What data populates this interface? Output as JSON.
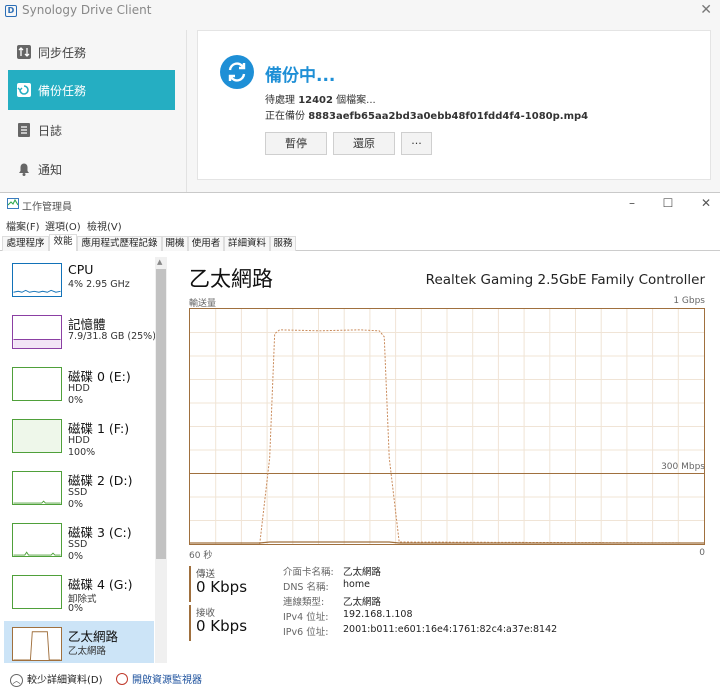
{
  "synology": {
    "title": "Synology Drive Client",
    "nav": [
      {
        "label": "同步任務",
        "icon": "sync-arrows-icon",
        "active": false
      },
      {
        "label": "備份任務",
        "icon": "backup-icon",
        "active": true
      },
      {
        "label": "日誌",
        "icon": "log-icon",
        "active": false
      },
      {
        "label": "通知",
        "icon": "bell-icon",
        "active": false
      }
    ],
    "status": "備份中...",
    "pending_prefix": "待處理",
    "pending_count": "12402",
    "pending_suffix": "個檔案...",
    "current_prefix": "正在備份",
    "current_file": "8883aefb65aa2bd3a0ebb48f01fdd4f4-1080p.mp4",
    "buttons": {
      "pause": "暫停",
      "restore": "還原",
      "more": "···"
    },
    "accent": "#25aec2"
  },
  "taskmgr": {
    "title": "工作管理員",
    "menu": [
      "檔案(F)",
      "選項(O)",
      "檢視(V)"
    ],
    "tabs": [
      "處理程序",
      "效能",
      "應用程式歷程記錄",
      "開機",
      "使用者",
      "詳細資料",
      "服務"
    ],
    "active_tab": 1,
    "list": [
      {
        "name": "CPU",
        "sub": "4%  2.95 GHz",
        "sub2": ""
      },
      {
        "name": "記憶體",
        "sub": "7.9/31.8 GB (25%)",
        "sub2": ""
      },
      {
        "name": "磁碟 0 (E:)",
        "sub": "HDD",
        "sub2": "0%"
      },
      {
        "name": "磁碟 1 (F:)",
        "sub": "HDD",
        "sub2": "100%"
      },
      {
        "name": "磁碟 2 (D:)",
        "sub": "SSD",
        "sub2": "0%"
      },
      {
        "name": "磁碟 3 (C:)",
        "sub": "SSD",
        "sub2": "0%"
      },
      {
        "name": "磁碟 4 (G:)",
        "sub": "卸除式",
        "sub2": "0%"
      },
      {
        "name": "乙太網路",
        "sub": "乙太網路",
        "sub2": ""
      }
    ],
    "detail": {
      "title": "乙太網路",
      "adapter": "Realtek Gaming 2.5GbE Family Controller",
      "throughput_label": "輸送量",
      "max_label": "1 Gbps",
      "mid_label": "300 Mbps",
      "time_left": "60 秒",
      "time_right": "0",
      "send_label": "傳送",
      "send_value": "0 Kbps",
      "recv_label": "接收",
      "recv_value": "0 Kbps",
      "props": [
        {
          "k": "介面卡名稱:",
          "v": "乙太網路"
        },
        {
          "k": "DNS 名稱:",
          "v": "home"
        },
        {
          "k": "連線類型:",
          "v": "乙太網路"
        },
        {
          "k": "IPv4 位址:",
          "v": "192.168.1.108"
        },
        {
          "k": "IPv6 位址:",
          "v": "2001:b011:e601:16e4:1761:82c4:a37e:8142"
        }
      ]
    },
    "footer": {
      "less_details": "較少詳細資料(D)",
      "resource_monitor": "開啟資源監視器"
    },
    "graph_color": "#a0703e"
  }
}
